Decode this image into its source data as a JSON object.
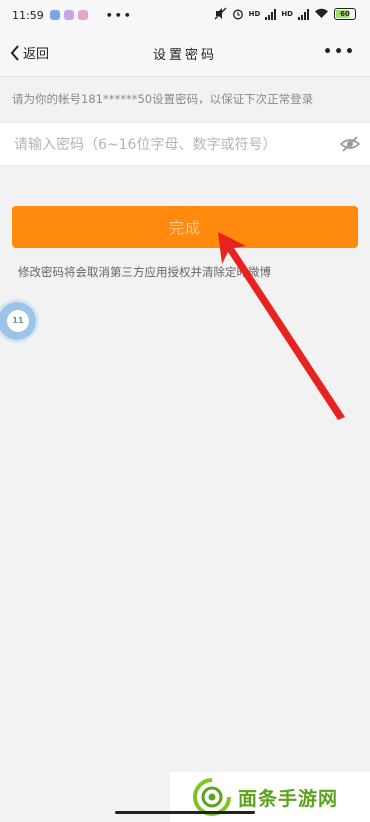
{
  "status_bar": {
    "time": "11:59",
    "dots": "•••",
    "hd": "HD",
    "battery": "60"
  },
  "nav": {
    "back_label": "返回",
    "title": "设置密码",
    "more_label": "•••"
  },
  "hint": "请为你的帐号181******50设置密码，以保证下次正常登录",
  "password": {
    "placeholder": "请输入密码（6~16位字母、数字或符号）",
    "value": ""
  },
  "done_button": {
    "label": "完成"
  },
  "notice": "修改密码将会取消第三方应用授权并清除定时微博",
  "float_ball": {
    "label": "11"
  },
  "watermark": {
    "text": "面条手游网"
  },
  "colors": {
    "accent": "#ff8a0e",
    "arrow": "#e8231f",
    "watermark": "#5aa31b"
  }
}
